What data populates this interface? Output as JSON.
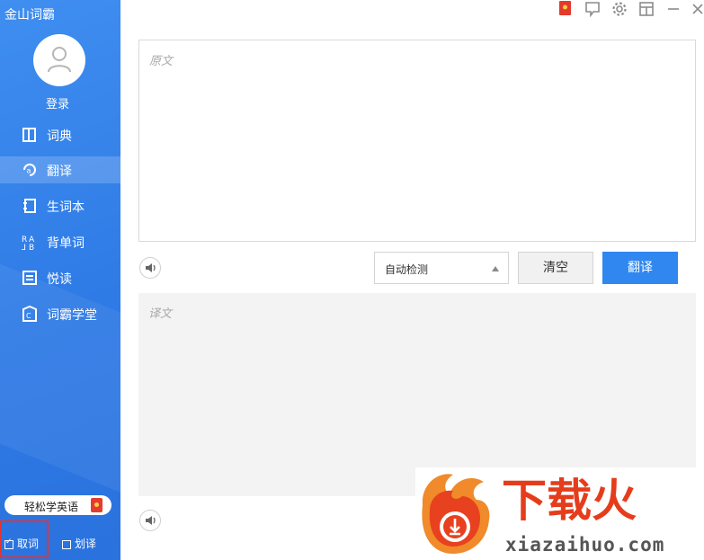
{
  "app": {
    "title": "金山词霸"
  },
  "user": {
    "login_label": "登录"
  },
  "nav": {
    "items": [
      {
        "label": "词典",
        "icon": "book-icon"
      },
      {
        "label": "翻译",
        "icon": "translate-icon",
        "active": true
      },
      {
        "label": "生词本",
        "icon": "notebook-icon"
      },
      {
        "label": "背单词",
        "icon": "flashcard-icon"
      },
      {
        "label": "悦读",
        "icon": "reading-icon"
      },
      {
        "label": "词霸学堂",
        "icon": "school-icon"
      }
    ]
  },
  "promo": {
    "label": "轻松学英语"
  },
  "bottom": {
    "take_word": {
      "label": "取词",
      "checked": true
    },
    "select_translate": {
      "label": "划译",
      "checked": false
    }
  },
  "translator": {
    "source_placeholder": "原文",
    "target_placeholder": "译文",
    "language": "自动检测",
    "clear_label": "清空",
    "translate_label": "翻译"
  },
  "watermark": {
    "brand": "下载火",
    "domain": "xiazaihuo.com"
  },
  "colors": {
    "sidebar": "#2f7be6",
    "primary": "#2f87ef",
    "highlight": "#e8322f",
    "brand": "#e53d1c"
  }
}
